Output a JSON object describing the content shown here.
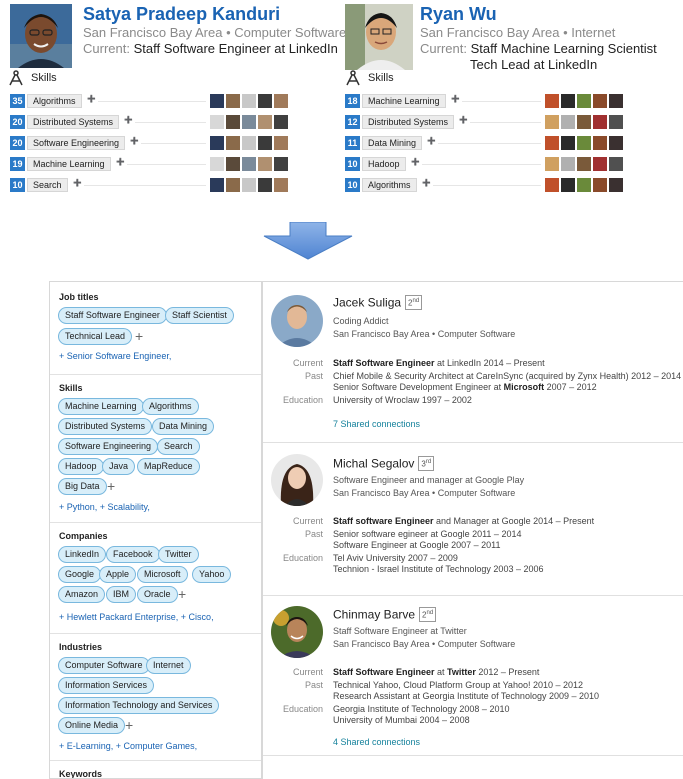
{
  "profiles": [
    {
      "name": "Satya Pradeep Kanduri",
      "location": "San Francisco Bay Area • Computer Software",
      "current_label": "Current:",
      "current": [
        "Staff Software Engineer at LinkedIn"
      ],
      "skills_label": "Skills",
      "skills": [
        {
          "count": "35",
          "name": "Algorithms"
        },
        {
          "count": "20",
          "name": "Distributed Systems"
        },
        {
          "count": "20",
          "name": "Software Engineering"
        },
        {
          "count": "19",
          "name": "Machine Learning"
        },
        {
          "count": "10",
          "name": "Search"
        }
      ]
    },
    {
      "name": "Ryan Wu",
      "location": "San Francisco Bay Area • Internet",
      "current_label": "Current:",
      "current": [
        "Staff Machine Learning Scientist",
        "Tech Lead at LinkedIn"
      ],
      "skills_label": "Skills",
      "skills": [
        {
          "count": "18",
          "name": "Machine Learning"
        },
        {
          "count": "12",
          "name": "Distributed Systems"
        },
        {
          "count": "11",
          "name": "Data Mining"
        },
        {
          "count": "10",
          "name": "Hadoop"
        },
        {
          "count": "10",
          "name": "Algorithms"
        }
      ]
    }
  ],
  "filters": {
    "job_titles": {
      "title": "Job titles",
      "pills": [
        "Staff Software Engineer",
        "Staff Scientist",
        "Technical Lead"
      ],
      "more": "+ Senior Software Engineer,"
    },
    "skills": {
      "title": "Skills",
      "pills": [
        "Machine Learning",
        "Algorithms",
        "Distributed Systems",
        "Data Mining",
        "Software Engineering",
        "Search",
        "Hadoop",
        "Java",
        "MapReduce",
        "Big Data"
      ],
      "more": "+ Python, + Scalability,"
    },
    "companies": {
      "title": "Companies",
      "pills": [
        "LinkedIn",
        "Facebook",
        "Twitter",
        "Google",
        "Apple",
        "Microsoft",
        "Yahoo",
        "Amazon",
        "IBM",
        "Oracle"
      ],
      "more": "+ Hewlett Packard Enterprise, + Cisco,"
    },
    "industries": {
      "title": "Industries",
      "pills": [
        "Computer Software",
        "Internet",
        "Information Services",
        "Information Technology and Services",
        "Online Media"
      ],
      "more": "+ E-Learning, + Computer Games,"
    },
    "keywords": {
      "title": "Keywords"
    },
    "plus_symbol": "+"
  },
  "results": [
    {
      "name": "Jacek Suliga",
      "degree": "2nd",
      "headline": "Coding Addict",
      "location": "San Francisco Bay Area • Computer Software",
      "current_label": "Current",
      "current_bold": "Staff Software Engineer",
      "current_rest": " at LinkedIn  2014 – Present",
      "past_label": "Past",
      "past": [
        {
          "pre": "Chief Mobile & Security Architect at CareInSync (acquired by Zynx Health)  2012 – 2014",
          "bold": "",
          "post": ""
        },
        {
          "pre": "Senior Software Development Engineer at ",
          "bold": "Microsoft",
          "post": "  2007 – 2012"
        }
      ],
      "education_label": "Education",
      "education": [
        "University of Wroclaw  1997 – 2002"
      ],
      "shared": "7 Shared connections"
    },
    {
      "name": "Michal Segalov",
      "degree": "3rd",
      "headline": "Software Engineer and manager at Google Play",
      "location": "San Francisco Bay Area • Computer Software",
      "current_label": "Current",
      "current_bold": "Staff software Engineer",
      "current_rest": " and Manager at Google  2014 – Present",
      "past_label": "Past",
      "past": [
        {
          "pre": "Senior software egineer at Google  2011 – 2014",
          "bold": "",
          "post": ""
        },
        {
          "pre": "Software Engineer at Google  2007 – 2011",
          "bold": "",
          "post": ""
        }
      ],
      "education_label": "Education",
      "education": [
        "Tel Aviv University  2007 – 2009",
        "Technion - Israel Institute of Technology  2003 – 2006"
      ],
      "shared": ""
    },
    {
      "name": "Chinmay Barve",
      "degree": "2nd",
      "headline": "Staff Software Engineer at Twitter",
      "location": "San Francisco Bay Area • Computer Software",
      "current_label": "Current",
      "current_bold": "Staff Software Engineer",
      "current_rest": " at ",
      "current_bold2": "Twitter",
      "current_rest2": "  2012 – Present",
      "past_label": "Past",
      "past": [
        {
          "pre": "Technical Yahoo, Cloud Platform Group at Yahoo!  2010 – 2012",
          "bold": "",
          "post": ""
        },
        {
          "pre": "Research Assistant at Georgia Institute of Technology  2009 – 2010",
          "bold": "",
          "post": ""
        }
      ],
      "education_label": "Education",
      "education": [
        "Georgia Institute of Technology  2008 – 2010",
        "University of Mumbai  2004 – 2008"
      ],
      "shared": "4 Shared connections"
    }
  ],
  "colors": {
    "accent_blue": "#1a63b3",
    "count_blue": "#2a7ac8",
    "pill_bg": "#d8eef9",
    "pill_border": "#79b8de",
    "shared_teal": "#16829c"
  }
}
